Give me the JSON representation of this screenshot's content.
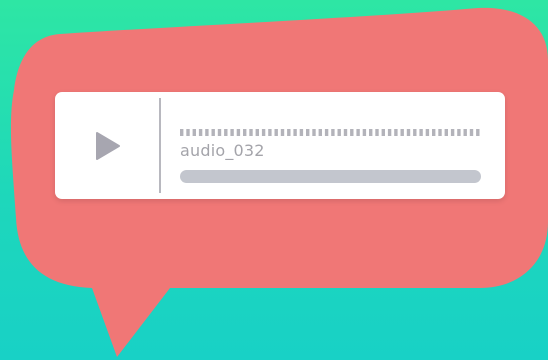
{
  "colors": {
    "background_top": "#2ee6a4",
    "background_bottom": "#18d1c6",
    "bubble": "#f07776",
    "card": "#ffffff",
    "play_icon": "#a7a6b0",
    "waveform": "#b3b3ba",
    "title_text": "#a4a4aa",
    "progress_track": "#c3c6ce"
  },
  "player": {
    "title": "audio_032",
    "play_icon": "play-icon",
    "progress": 0
  }
}
